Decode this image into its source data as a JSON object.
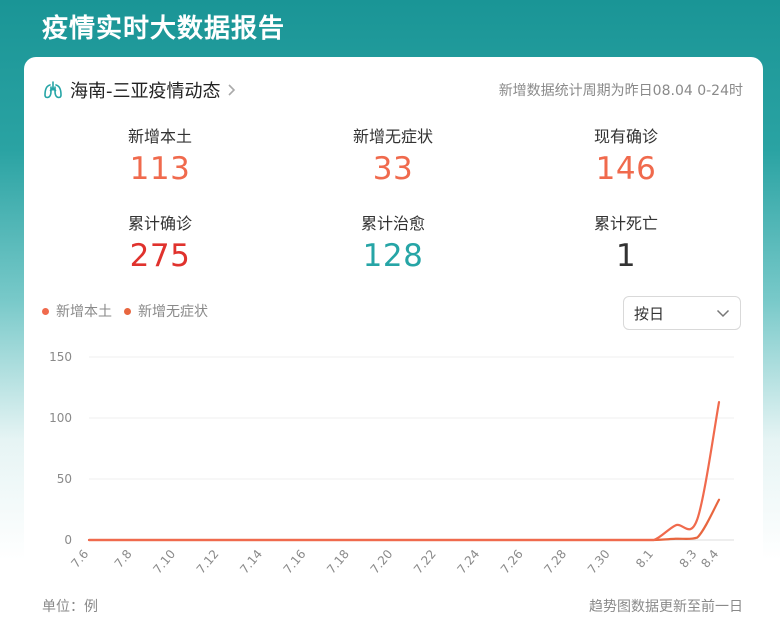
{
  "page": {
    "title": "疫情实时大数据报告"
  },
  "card": {
    "header_title": "海南-三亚疫情动态",
    "period_note": "新增数据统计周期为昨日08.04 0-24时"
  },
  "stats": [
    {
      "label": "新增本土",
      "value": "113",
      "color": "#f06a4d"
    },
    {
      "label": "新增无症状",
      "value": "33",
      "color": "#f06a4d"
    },
    {
      "label": "现有确诊",
      "value": "146",
      "color": "#f06a4d"
    },
    {
      "label": "累计确诊",
      "value": "275",
      "color": "#e0322d"
    },
    {
      "label": "累计治愈",
      "value": "128",
      "color": "#26a5a6"
    },
    {
      "label": "累计死亡",
      "value": "1",
      "color": "#333333"
    }
  ],
  "legend": [
    {
      "label": "新增本土",
      "color": "#f06a4d"
    },
    {
      "label": "新增无症状",
      "color": "#e8663f"
    }
  ],
  "select": {
    "value": "按日"
  },
  "footer": {
    "unit": "单位：例",
    "note": "趋势图数据更新至前一日"
  },
  "chart_data": {
    "type": "line",
    "x": [
      "7.6",
      "7.7",
      "7.8",
      "7.9",
      "7.10",
      "7.11",
      "7.12",
      "7.13",
      "7.14",
      "7.15",
      "7.16",
      "7.17",
      "7.18",
      "7.19",
      "7.20",
      "7.21",
      "7.22",
      "7.23",
      "7.24",
      "7.25",
      "7.26",
      "7.27",
      "7.28",
      "7.29",
      "7.30",
      "7.31",
      "8.1",
      "8.2",
      "8.3",
      "8.4"
    ],
    "x_tick_labels": [
      "7.6",
      "7.8",
      "7.10",
      "7.12",
      "7.14",
      "7.16",
      "7.18",
      "7.20",
      "7.22",
      "7.24",
      "7.26",
      "7.28",
      "7.30",
      "8.1",
      "8.3",
      "8.4"
    ],
    "series": [
      {
        "name": "新增本土",
        "color": "#f06a4d",
        "values": [
          0,
          0,
          0,
          0,
          0,
          0,
          0,
          0,
          0,
          0,
          0,
          0,
          0,
          0,
          0,
          0,
          0,
          0,
          0,
          0,
          0,
          0,
          0,
          0,
          0,
          0,
          0,
          12,
          17,
          113
        ]
      },
      {
        "name": "新增无症状",
        "color": "#e8663f",
        "values": [
          0,
          0,
          0,
          0,
          0,
          0,
          0,
          0,
          0,
          0,
          0,
          0,
          0,
          0,
          0,
          0,
          0,
          0,
          0,
          0,
          0,
          0,
          0,
          0,
          0,
          0,
          0,
          1,
          2,
          33
        ]
      }
    ],
    "y_ticks": [
      0,
      50,
      100,
      150
    ],
    "ylim": [
      0,
      150
    ],
    "grid": true,
    "legend_position": "top-left"
  }
}
